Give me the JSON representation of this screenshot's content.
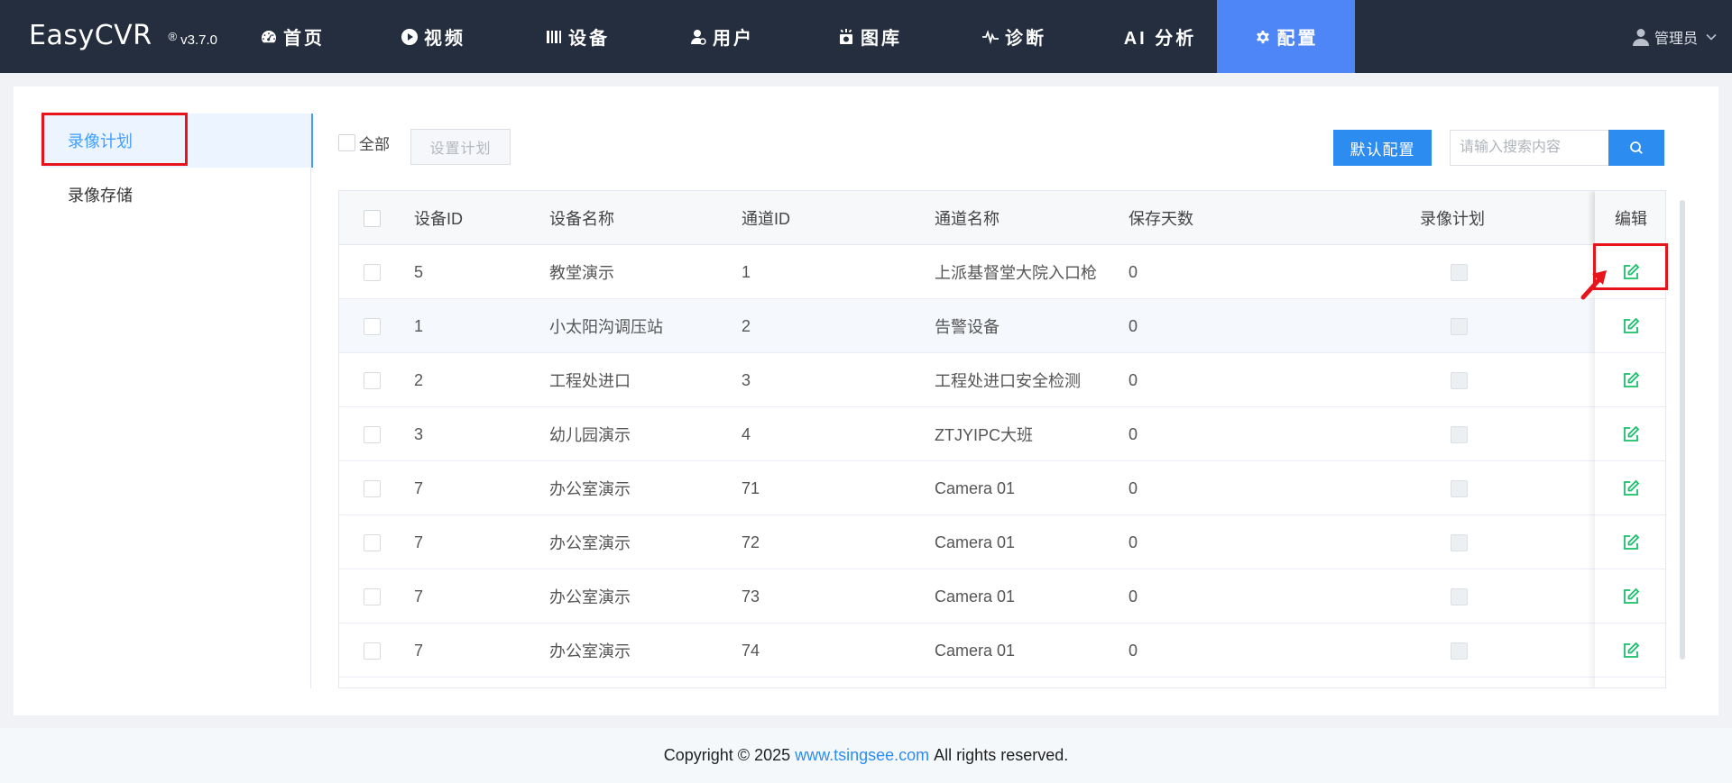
{
  "header": {
    "brand": "EasyCVR",
    "registered": "®",
    "version": "v3.7.0",
    "nav": [
      {
        "label": "首页",
        "icon": "dashboard-icon"
      },
      {
        "label": "视频",
        "icon": "play-icon"
      },
      {
        "label": "设备",
        "icon": "device-icon"
      },
      {
        "label": "用户",
        "icon": "user-icon"
      },
      {
        "label": "图库",
        "icon": "camera-icon"
      },
      {
        "label": "诊断",
        "icon": "pulse-icon"
      },
      {
        "label": "AI 分析",
        "icon": ""
      },
      {
        "label": "配置",
        "icon": "gear-icon"
      }
    ],
    "active_nav": "配置",
    "user": "管理员"
  },
  "sidebar": {
    "items": [
      {
        "label": "录像计划",
        "active": true
      },
      {
        "label": "录像存储",
        "active": false
      }
    ]
  },
  "toolbar": {
    "select_all_label": "全部",
    "set_plan_label": "设置计划",
    "default_config_label": "默认配置",
    "search_placeholder": "请输入搜索内容"
  },
  "table": {
    "columns": [
      "设备ID",
      "设备名称",
      "通道ID",
      "通道名称",
      "保存天数",
      "录像计划",
      "编辑"
    ],
    "rows": [
      {
        "device_id": "5",
        "device_name": "教堂演示",
        "channel_id": "1",
        "channel_name": "上派基督堂大院入口枪",
        "days": "0"
      },
      {
        "device_id": "1",
        "device_name": "小太阳沟调压站",
        "channel_id": "2",
        "channel_name": "告警设备",
        "days": "0"
      },
      {
        "device_id": "2",
        "device_name": "工程处进口",
        "channel_id": "3",
        "channel_name": "工程处进口安全检测",
        "days": "0"
      },
      {
        "device_id": "3",
        "device_name": "幼儿园演示",
        "channel_id": "4",
        "channel_name": "ZTJYIPC大班",
        "days": "0"
      },
      {
        "device_id": "7",
        "device_name": "办公室演示",
        "channel_id": "71",
        "channel_name": "Camera 01",
        "days": "0"
      },
      {
        "device_id": "7",
        "device_name": "办公室演示",
        "channel_id": "72",
        "channel_name": "Camera 01",
        "days": "0"
      },
      {
        "device_id": "7",
        "device_name": "办公室演示",
        "channel_id": "73",
        "channel_name": "Camera 01",
        "days": "0"
      },
      {
        "device_id": "7",
        "device_name": "办公室演示",
        "channel_id": "74",
        "channel_name": "Camera 01",
        "days": "0"
      }
    ]
  },
  "footer": {
    "prefix": "Copyright © 2025",
    "link": "www.tsingsee.com",
    "suffix": "All rights reserved."
  },
  "colors": {
    "header_bg": "#252e3e",
    "active_nav": "#4f86f7",
    "primary": "#2d8cf0",
    "edit_icon": "#19be6b",
    "highlight": "#e8141b"
  }
}
